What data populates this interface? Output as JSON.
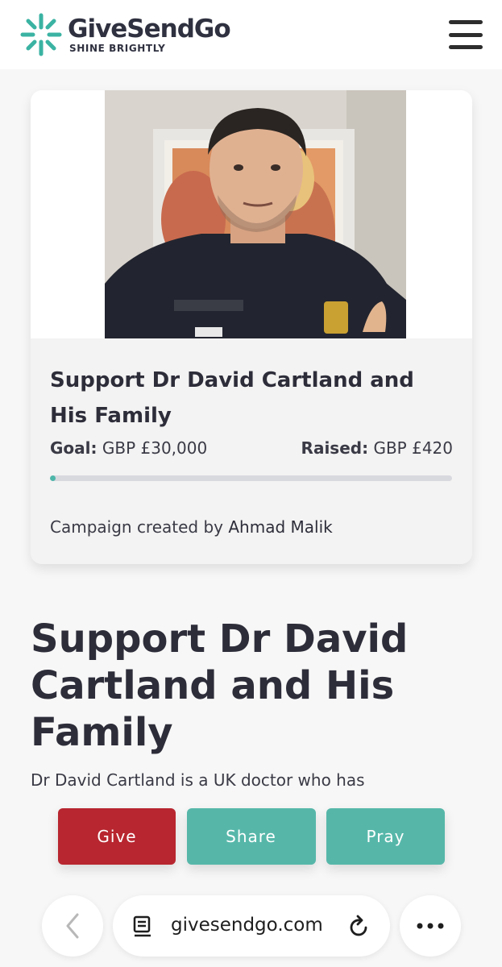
{
  "header": {
    "brand_name": "GiveSendGo",
    "tagline": "SHINE BRIGHTLY",
    "brand_color": "#3bb3a3",
    "menu_icon": "hamburger-menu-icon"
  },
  "campaign_card": {
    "title": "Support Dr David Cartland and His Family",
    "goal_label": "Goal:",
    "goal_value": "GBP £30,000",
    "raised_label": "Raised:",
    "raised_value": "GBP £420",
    "progress_fraction": 0.014,
    "progress_color": "#4db6a9",
    "creator_prefix": "Campaign created by",
    "creator_name": "Ahmad Malik"
  },
  "main": {
    "title": "Support Dr David Cartland and His Family",
    "description": "Dr David Cartland is a UK doctor who has"
  },
  "actions": {
    "give_label": "Give",
    "share_label": "Share",
    "pray_label": "Pray",
    "give_color": "#b8262f",
    "share_color": "#56b7a9",
    "pray_color": "#56b7a9"
  },
  "browser": {
    "url": "givesendgo.com",
    "back_icon": "chevron-left-icon",
    "reader_icon": "reader-mode-icon",
    "reload_icon": "reload-icon",
    "more_icon": "more-dots-icon"
  }
}
